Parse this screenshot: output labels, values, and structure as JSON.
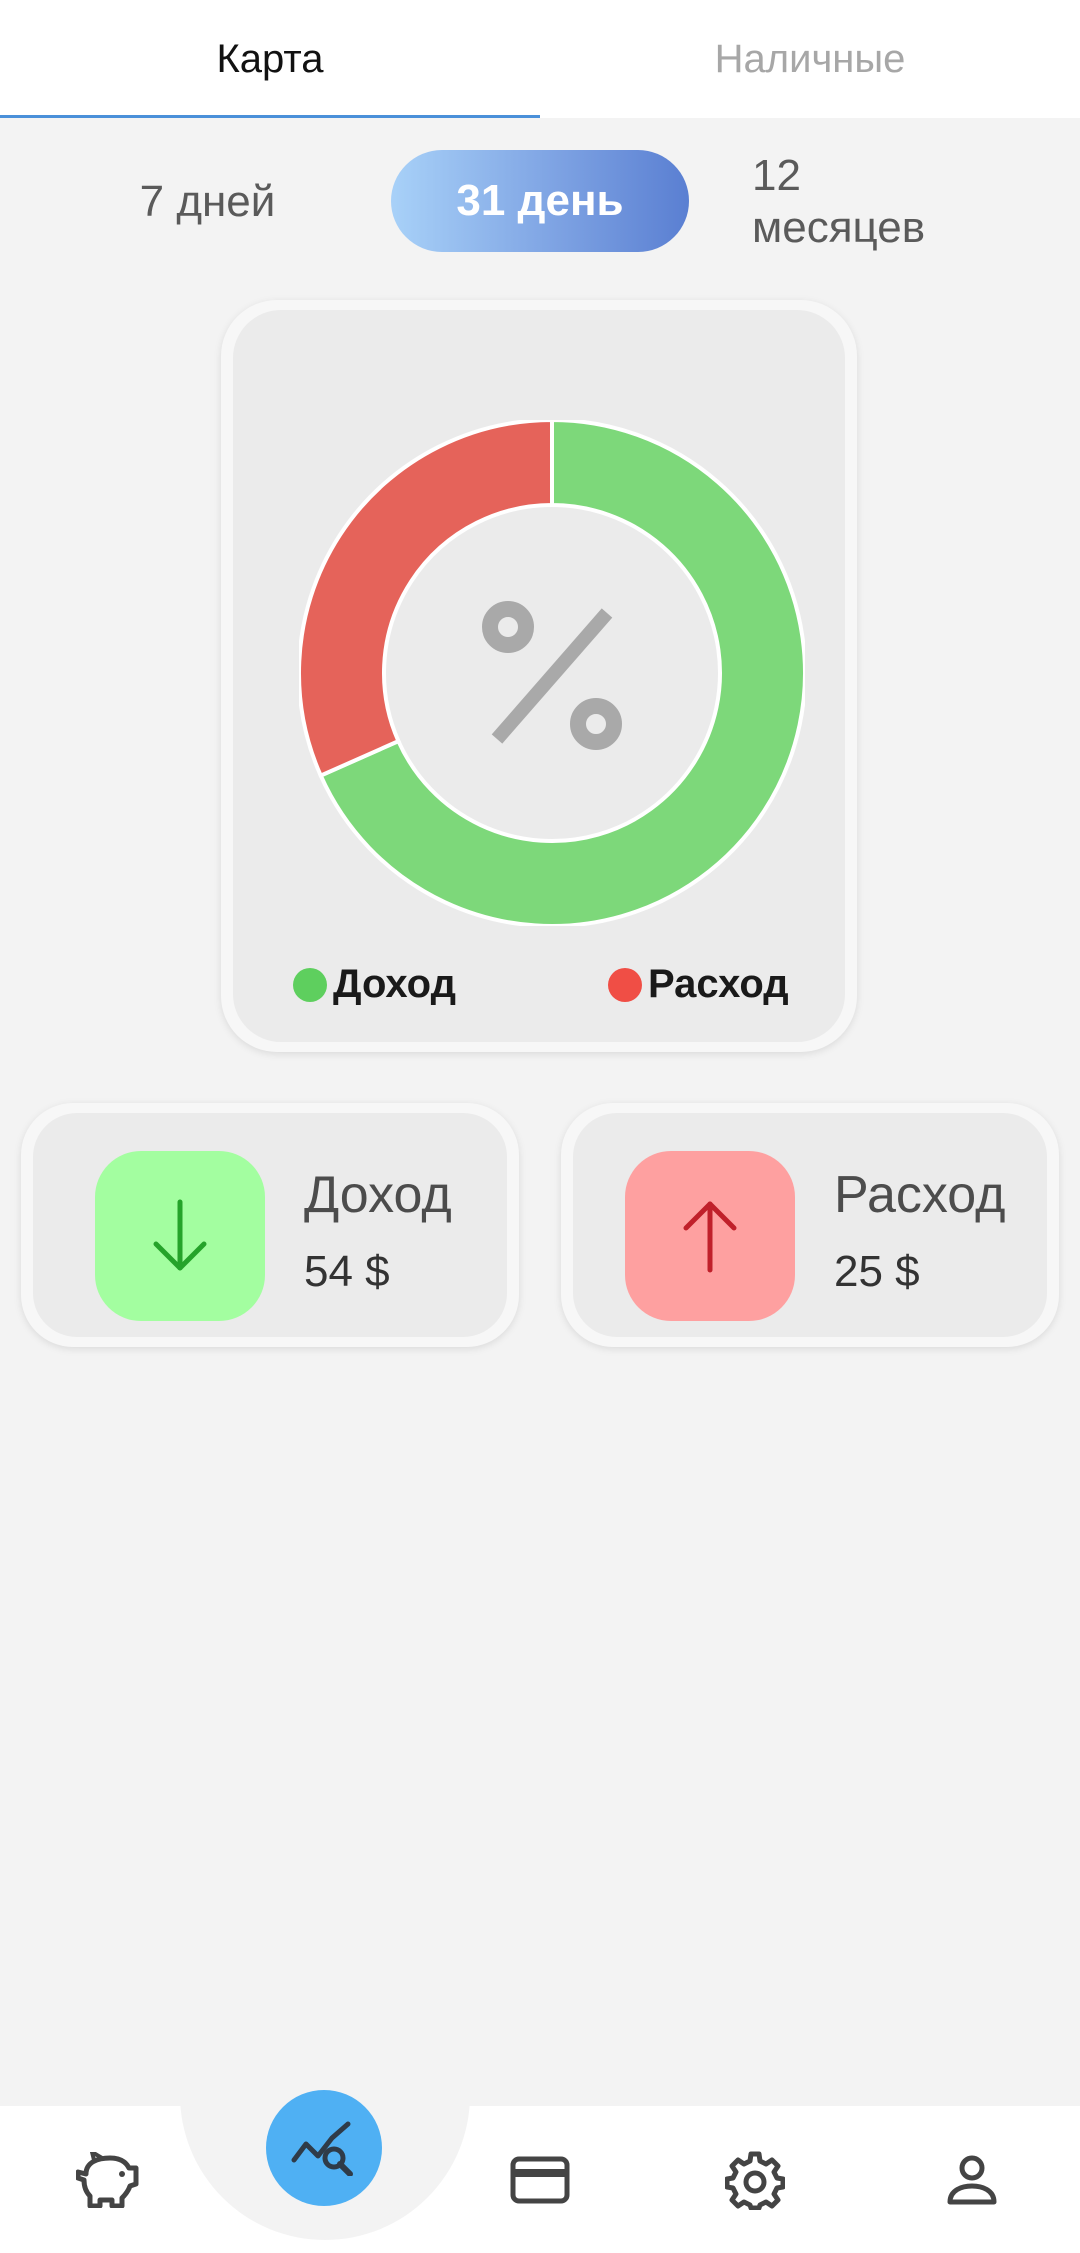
{
  "tabs": [
    {
      "label": "Карта",
      "active": true
    },
    {
      "label": "Наличные",
      "active": false
    }
  ],
  "periods": [
    {
      "label": "7 дней",
      "selected": false
    },
    {
      "label": "31 день",
      "selected": true
    },
    {
      "label": "12\nмесяцев",
      "selected": false
    }
  ],
  "chart": {
    "center_icon": "percent-icon",
    "legend": [
      {
        "label": "Доход",
        "color": "#5ecf5e"
      },
      {
        "label": "Расход",
        "color": "#f04e45"
      }
    ]
  },
  "chart_data": {
    "type": "pie",
    "categories": [
      "Доход",
      "Расход"
    ],
    "values": [
      54,
      25
    ],
    "colors": [
      "#7dd87a",
      "#e5635a"
    ]
  },
  "summary": {
    "income": {
      "title": "Доход",
      "value": "54  $",
      "icon": "arrow-down-icon",
      "bg": "#a3fea0",
      "icon_color": "#25a32a"
    },
    "expense": {
      "title": "Расход",
      "value": "25  $",
      "icon": "arrow-up-icon",
      "bg": "#fea0a0",
      "icon_color": "#c0202a"
    }
  },
  "nav": {
    "items": [
      "piggy-bank-icon",
      "analytics-icon",
      "credit-card-icon",
      "gear-icon",
      "person-icon"
    ],
    "active": "analytics-icon",
    "accent": "#4fb0f3"
  }
}
